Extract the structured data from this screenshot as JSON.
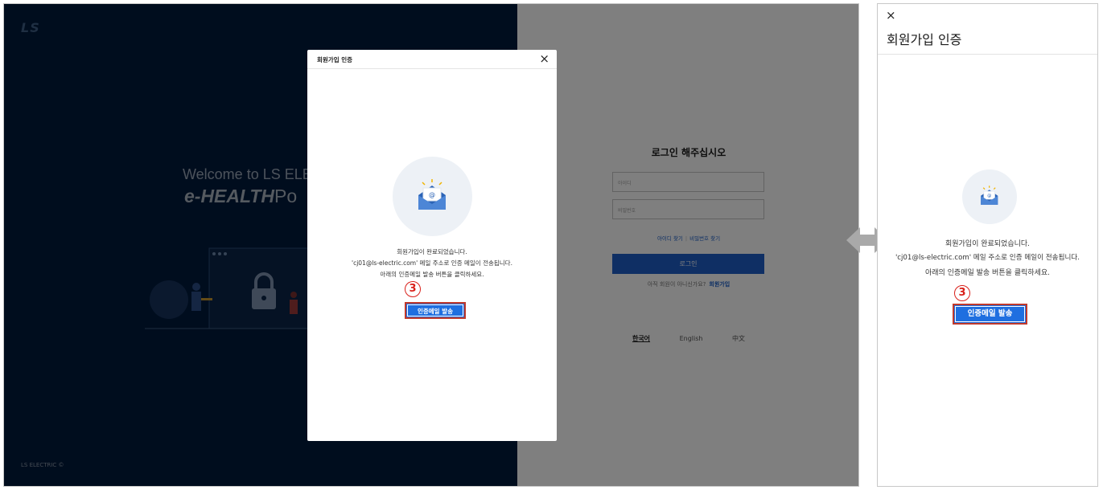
{
  "desktop": {
    "logo": "LS",
    "welcome_text": "Welcome to LS ELEC",
    "ehealth_prefix": "e-HEALTH",
    "ehealth_suffix": "Po",
    "copyright": "LS ELECTRIC ©",
    "login": {
      "title": "로그인 해주십시오",
      "id_placeholder": "아이디",
      "password_placeholder": "비밀번호",
      "find_id": "아이디 찾기",
      "find_password": "비밀번호 찾기",
      "login_button": "로그인",
      "signup_prompt": "아직 회원이 아니신가요?",
      "signup_link": "회원가입"
    },
    "languages": [
      "한국어",
      "English",
      "中文"
    ],
    "modal": {
      "title": "회원가입 인증",
      "close": "×",
      "message_line1": "회원가입이 완료되었습니다.",
      "message_line2": "'cj01@ls-electric.com' 메일 주소로 인증 메일이 전송됩니다.",
      "message_line3": "아래의 인증메일 발송 버튼을 클릭하세요.",
      "send_button": "인증메일 발송",
      "step_marker": "3"
    }
  },
  "mobile": {
    "close": "×",
    "title": "회원가입 인증",
    "message_line1": "회원가입이 완료되었습니다.",
    "message_line2": "'cj01@ls-electric.com' 메일 주소로 인증 메일이 전송됩니다.",
    "message_line3": "아래의 인증메일 발송 버튼을 클릭하세요.",
    "send_button": "인증메일 발송",
    "step_marker": "3"
  },
  "colors": {
    "brand_navy": "#001a3d",
    "primary_blue": "#1f6fe0",
    "highlight_red": "#c0392b"
  },
  "icons": {
    "mail": "envelope-icon",
    "arrow": "double-arrow-icon"
  }
}
